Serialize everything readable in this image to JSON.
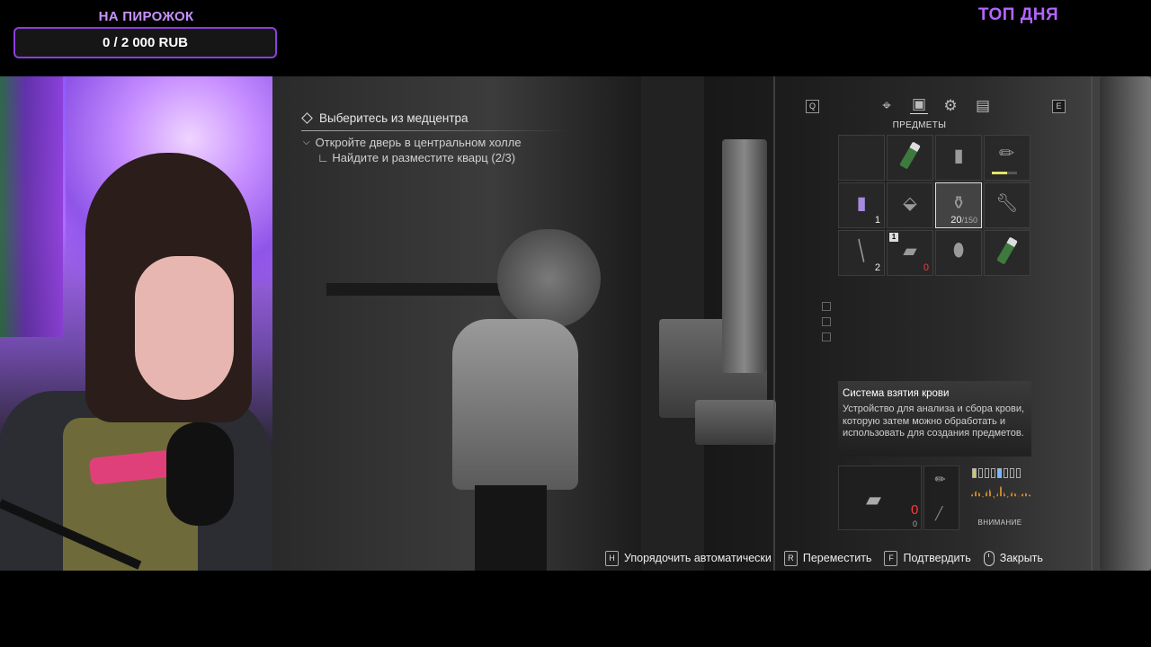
{
  "overlay": {
    "donation_title": "НА ПИРОЖОК",
    "donation_progress": "0 / 2 000 RUB",
    "top_label": "ТОП ДНЯ",
    "accent_color": "#b465ff"
  },
  "objectives": {
    "main": "Выберитесь из медцентра",
    "sub": "Откройте дверь в центральном холле",
    "subsub": "∟ Найдите и разместите кварц (2/3)"
  },
  "inventory": {
    "key_left": "Q",
    "key_right": "E",
    "tab_active_label": "ПРЕДМЕТЫ",
    "tabs": [
      "crosshair-icon",
      "backpack-icon",
      "gears-icon",
      "files-icon"
    ],
    "slots": [
      {
        "icon": "empty",
        "qty": ""
      },
      {
        "icon": "green-injector-icon",
        "qty": ""
      },
      {
        "icon": "canister-icon",
        "qty": ""
      },
      {
        "icon": "syringe-icon",
        "qty": "",
        "condition": 0.6
      },
      {
        "icon": "battery-icon",
        "qty": "1"
      },
      {
        "icon": "quartz-icon",
        "qty": ""
      },
      {
        "icon": "blood-system-icon",
        "qty": "20",
        "qty_max": "/150",
        "selected": true
      },
      {
        "icon": "wrench-icon",
        "qty": ""
      },
      {
        "icon": "scalpel-icon",
        "qty": "2"
      },
      {
        "icon": "pistol-icon",
        "qty": "0",
        "badge": "1",
        "qty_red": true
      },
      {
        "icon": "grenade-icon",
        "qty": ""
      },
      {
        "icon": "green-injector-icon",
        "qty": ""
      }
    ],
    "description": {
      "title": "Система взятия крови",
      "body": "Устройство для анализа и сбора крови, которую затем можно обработать и использовать для создания предметов."
    },
    "equipped": {
      "weapon_ammo": "0",
      "weapon_reserve": "0",
      "attention_label": "ВНИМАНИЕ"
    }
  },
  "hints": [
    {
      "key": "H",
      "label": "Упорядочить автоматически"
    },
    {
      "key": "R",
      "label": "Переместить"
    },
    {
      "key": "F",
      "label": "Подтвердить"
    },
    {
      "key": "mouse",
      "label": "Закрыть"
    }
  ]
}
